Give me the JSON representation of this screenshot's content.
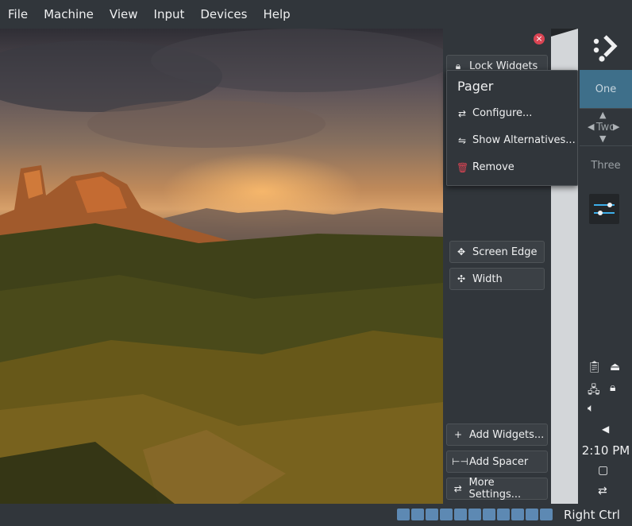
{
  "menubar": {
    "items": [
      "File",
      "Machine",
      "View",
      "Input",
      "Devices",
      "Help"
    ]
  },
  "toolbox": {
    "close_icon": "close-icon",
    "lock_widgets": "Lock Widgets",
    "screen_edge": "Screen Edge",
    "width": "Width",
    "add_widgets": "Add Widgets...",
    "add_spacer": "Add Spacer",
    "more_settings": "More Settings..."
  },
  "popup": {
    "title": "Pager",
    "configure": "Configure...",
    "show_alternatives": "Show Alternatives...",
    "remove": "Remove"
  },
  "panel": {
    "desktops": [
      "One",
      "Two",
      "Three"
    ],
    "clock": "2:10 PM"
  },
  "statusbar": {
    "host_key": "Right Ctrl"
  },
  "colors": {
    "accent": "#3e6f8a",
    "danger": "#da4453",
    "panel_bg": "#31363b"
  }
}
